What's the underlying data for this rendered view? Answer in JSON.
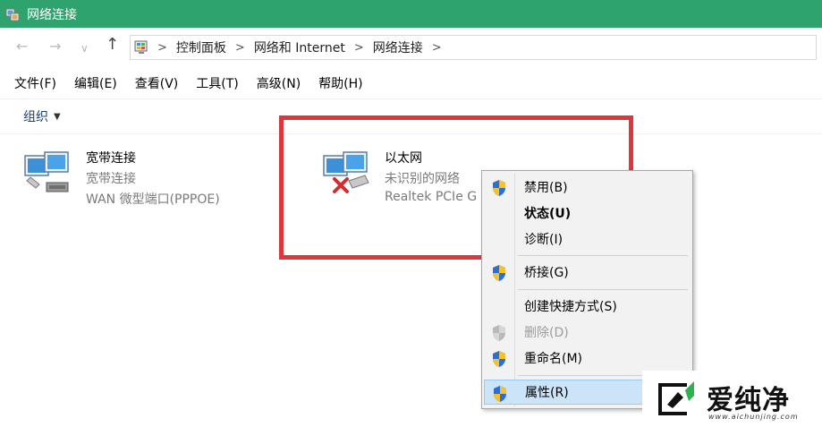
{
  "window": {
    "title": "网络连接"
  },
  "nav": {
    "back": "←",
    "forward": "→",
    "recent": "∨",
    "up": "↑"
  },
  "breadcrumbs": [
    "控制面板",
    "网络和 Internet",
    "网络连接"
  ],
  "breadcrumb_sep": ">",
  "menubar": [
    "文件(F)",
    "编辑(E)",
    "查看(V)",
    "工具(T)",
    "高级(N)",
    "帮助(H)"
  ],
  "toolbar": {
    "organize": "组织",
    "caret": "▼"
  },
  "connections": [
    {
      "name": "宽带连接",
      "status": "宽带连接",
      "device": "WAN 微型端口(PPPOE)",
      "icon": "broadband-connection-icon"
    },
    {
      "name": "以太网",
      "status": "未识别的网络",
      "device": "Realtek PCIe G",
      "icon": "ethernet-disconnected-icon"
    }
  ],
  "context_menu": [
    {
      "label": "禁用(B)",
      "shield": true,
      "bold": false,
      "disabled": false
    },
    {
      "label": "状态(U)",
      "shield": false,
      "bold": true,
      "disabled": false
    },
    {
      "label": "诊断(I)",
      "shield": false,
      "bold": false,
      "disabled": false
    },
    {
      "label": "桥接(G)",
      "shield": true,
      "bold": false,
      "disabled": false
    },
    {
      "label": "创建快捷方式(S)",
      "shield": false,
      "bold": false,
      "disabled": false
    },
    {
      "label": "删除(D)",
      "shield": true,
      "bold": false,
      "disabled": true
    },
    {
      "label": "重命名(M)",
      "shield": true,
      "bold": false,
      "disabled": false
    },
    {
      "label": "属性(R)",
      "shield": true,
      "bold": false,
      "disabled": false,
      "selected": true
    }
  ],
  "watermark": {
    "text": "爱纯净",
    "url": "www.aichunjing.com"
  },
  "colors": {
    "titlebar": "#2fa36e",
    "highlight": "#d9393d",
    "selected": "#cce4f7"
  }
}
